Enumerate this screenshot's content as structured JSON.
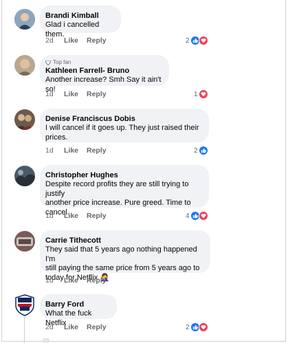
{
  "comments": [
    {
      "name": "Brandi Kimball",
      "text": [
        "Glad i cancelled them."
      ],
      "time": "2d",
      "like": "Like",
      "reply": "Reply",
      "reactions": {
        "count": "2",
        "types": [
          "like",
          "love"
        ]
      }
    },
    {
      "badge": "Top fan",
      "name": "Kathleen Farrell- Bruno",
      "text": [
        "Another increase? Smh Say it ain't so!"
      ],
      "time": "1d",
      "like": "Like",
      "reply": "Reply",
      "reactions": {
        "count": "1",
        "types": [
          "love"
        ]
      }
    },
    {
      "name": "Denise Franciscus Dobis",
      "text": [
        "I will cancel if it goes up. They just raised their",
        "prices."
      ],
      "time": "1d",
      "like": "Like",
      "reply": "Reply",
      "reactions": {
        "count": "2",
        "types": [
          "like"
        ]
      }
    },
    {
      "name": "Christopher Hughes",
      "text": [
        "Despite record profits they are still trying to justify",
        "another price increase. Pure greed. Time to",
        "cancel."
      ],
      "time": "1d",
      "like": "Like",
      "reply": "Reply",
      "reactions": {
        "count": "4",
        "types": [
          "like",
          "love"
        ]
      }
    },
    {
      "name": "Carrie Tithecott",
      "text": [
        "They said that 5 years ago nothing  happened I'm",
        "still paying the same price from 5 years ago to",
        "today for  Netflix"
      ],
      "emoji": "🤦‍♀️",
      "time": "1d",
      "like": "Like",
      "reply": "Reply"
    },
    {
      "name": "Barry Ford",
      "text": [
        "What the fuck Netflix"
      ],
      "time": "2d",
      "like": "Like",
      "reply": "Reply",
      "reactions": {
        "count": "2",
        "types": [
          "like",
          "love"
        ]
      }
    }
  ],
  "colors": {
    "like": "#1877f2",
    "love": "#f33e58",
    "bubble": "#f0f2f5",
    "meta": "#65676b"
  }
}
